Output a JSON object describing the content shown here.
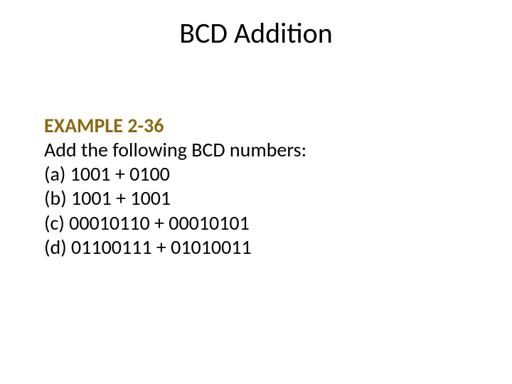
{
  "title": "BCD Addition",
  "example_label": "EXAMPLE 2-36",
  "prompt": "Add the following BCD numbers:",
  "items": {
    "a": "(a) 1001 + 0100",
    "b": "(b) 1001 + 1001",
    "c": "(c) 00010110 + 00010101",
    "d": "(d) 01100111 + 01010011"
  }
}
